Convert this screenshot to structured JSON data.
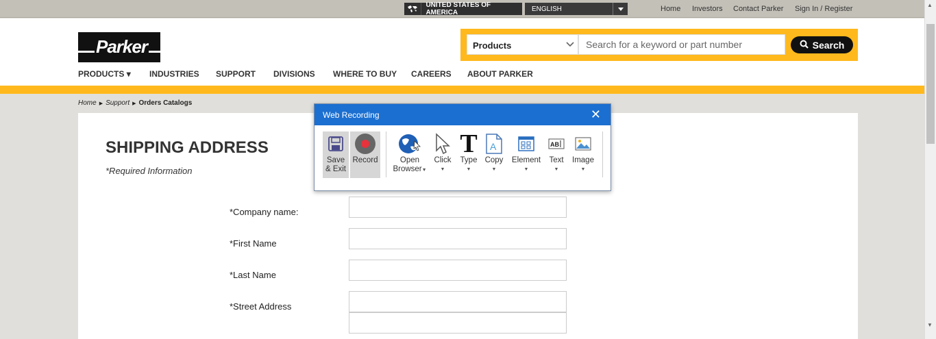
{
  "topbar": {
    "country": "UNITED STATES OF AMERICA",
    "language": "ENGLISH",
    "links": [
      "Home",
      "Investors",
      "Contact Parker",
      "Sign In / Register"
    ]
  },
  "header": {
    "logo_text": "Parker",
    "search": {
      "category": "Products",
      "placeholder": "Search for a keyword or part number",
      "button": "Search"
    },
    "nav": [
      "PRODUCTS",
      "INDUSTRIES",
      "SUPPORT",
      "DIVISIONS",
      "WHERE TO BUY",
      "CAREERS",
      "ABOUT PARKER"
    ]
  },
  "breadcrumb": [
    "Home",
    "Support",
    "Orders Catalogs"
  ],
  "form": {
    "title": "SHIPPING ADDRESS",
    "required_note": "*Required Information",
    "fields": [
      "*Company name:",
      "*First Name",
      "*Last Name",
      "*Street Address"
    ]
  },
  "recorder": {
    "title": "Web Recording",
    "tools": {
      "save_a": "Save",
      "save_b": "& Exit",
      "record": "Record",
      "open_a": "Open",
      "open_b": "Browser",
      "click": "Click",
      "type": "Type",
      "copy": "Copy",
      "element": "Element",
      "text": "Text",
      "image": "Image"
    }
  },
  "colors": {
    "accent": "#ffb91d",
    "recorder_title": "#1b6fd0"
  }
}
